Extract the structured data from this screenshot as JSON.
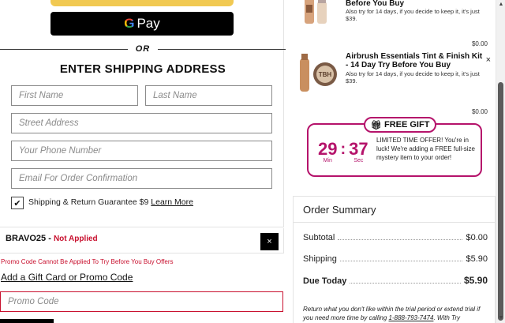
{
  "checkout": {
    "or_label": "OR",
    "gpay_label": "Pay",
    "gpay_g": "G",
    "shipping_title": "ENTER SHIPPING ADDRESS",
    "fields": {
      "first_name": "First Name",
      "last_name": "Last Name",
      "street": "Street Address",
      "phone": "Your Phone Number",
      "email": "Email For Order Confirmation"
    },
    "guarantee_text": "Shipping & Return Guarantee $9",
    "learn_more": "Learn More",
    "promo": {
      "code": "BRAVO25",
      "separator": " - ",
      "status": "Not Applied",
      "remove": "×",
      "error": "Promo Code Cannot Be Applied To Try Before You Buy Offers",
      "gift_link": "Add a Gift Card or Promo Code",
      "placeholder": "Promo Code"
    }
  },
  "cart": {
    "items": [
      {
        "title": "Before You Buy",
        "desc": "Also try for 14 days, if you decide to keep it, it's just $39.",
        "price": "$0.00"
      },
      {
        "title": "Airbrush Essentials Tint & Finish Kit - 14 Day Try Before You Buy",
        "desc": "Also try for 14 days, if you decide to keep it, it's just $39.",
        "remove": "×",
        "price": "$0.00"
      }
    ],
    "gift": {
      "badge": "FREE GIFT",
      "minutes": "29",
      "colon": ":",
      "seconds": "37",
      "min_label": "Min",
      "sec_label": "Sec",
      "text": "LIMITED TIME OFFER! You're in luck! We're adding a FREE full-size mystery item to your order!"
    }
  },
  "summary": {
    "title": "Order Summary",
    "rows": [
      {
        "label": "Subtotal",
        "value": "$0.00"
      },
      {
        "label": "Shipping",
        "value": "$5.90"
      },
      {
        "label": "Due Today",
        "value": "$5.90"
      }
    ],
    "note_before": "Return what you don't like within the trial period or extend trial if you need more time by calling ",
    "phone": "1-888-793-7474",
    "note_after": ". With Try"
  },
  "colors": {
    "accent": "#b5136b",
    "error": "#c8102e",
    "gpay_bg": "#000000",
    "paypal_yellow": "#f1c952"
  },
  "icons": {
    "checkbox": "check-icon",
    "gift": "gift-icon",
    "close": "close-icon"
  }
}
